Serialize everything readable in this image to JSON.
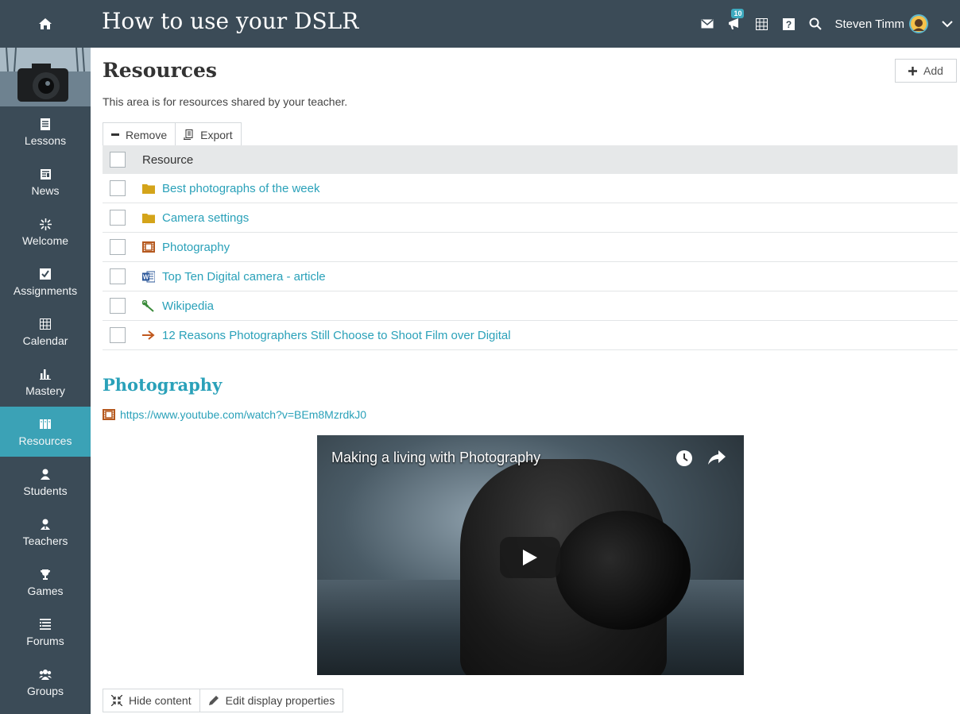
{
  "header": {
    "course_title": "How to use your DSLR",
    "notification_count": "10",
    "user_name": "Steven Timm"
  },
  "sidebar": {
    "items": [
      {
        "label": "Lessons",
        "icon": "lessons-icon"
      },
      {
        "label": "News",
        "icon": "news-icon"
      },
      {
        "label": "Welcome",
        "icon": "welcome-icon"
      },
      {
        "label": "Assignments",
        "icon": "assignments-icon"
      },
      {
        "label": "Calendar",
        "icon": "calendar-icon"
      },
      {
        "label": "Mastery",
        "icon": "mastery-icon"
      },
      {
        "label": "Resources",
        "icon": "resources-icon",
        "active": true
      },
      {
        "label": "Students",
        "icon": "student-icon"
      },
      {
        "label": "Teachers",
        "icon": "teacher-icon"
      },
      {
        "label": "Games",
        "icon": "trophy-icon"
      },
      {
        "label": "Forums",
        "icon": "forums-icon"
      },
      {
        "label": "Groups",
        "icon": "groups-icon"
      }
    ]
  },
  "main": {
    "title": "Resources",
    "add_label": "Add",
    "subtitle": "This area is for resources shared by your teacher.",
    "toolbar": {
      "remove_label": "Remove",
      "export_label": "Export"
    },
    "table": {
      "column_header": "Resource",
      "rows": [
        {
          "label": "Best photographs of the week",
          "icon": "folder-icon"
        },
        {
          "label": "Camera settings",
          "icon": "folder-icon"
        },
        {
          "label": "Photography",
          "icon": "film-icon"
        },
        {
          "label": "Top Ten Digital camera - article",
          "icon": "word-document-icon"
        },
        {
          "label": "Wikipedia",
          "icon": "wrench-icon"
        },
        {
          "label": "12 Reasons Photographers Still Choose to Shoot Film over Digital",
          "icon": "arrow-right-icon"
        }
      ]
    },
    "detail": {
      "title": "Photography",
      "url": "https://www.youtube.com/watch?v=BEm8MzrdkJ0",
      "video_title": "Making a living with Photography"
    },
    "bottom_toolbar": {
      "hide_label": "Hide content",
      "edit_label": "Edit display properties"
    }
  },
  "colors": {
    "header_bg": "#3b4b57",
    "accent": "#3ba2b6",
    "link": "#2aa1b9",
    "folder": "#d4a41a"
  }
}
